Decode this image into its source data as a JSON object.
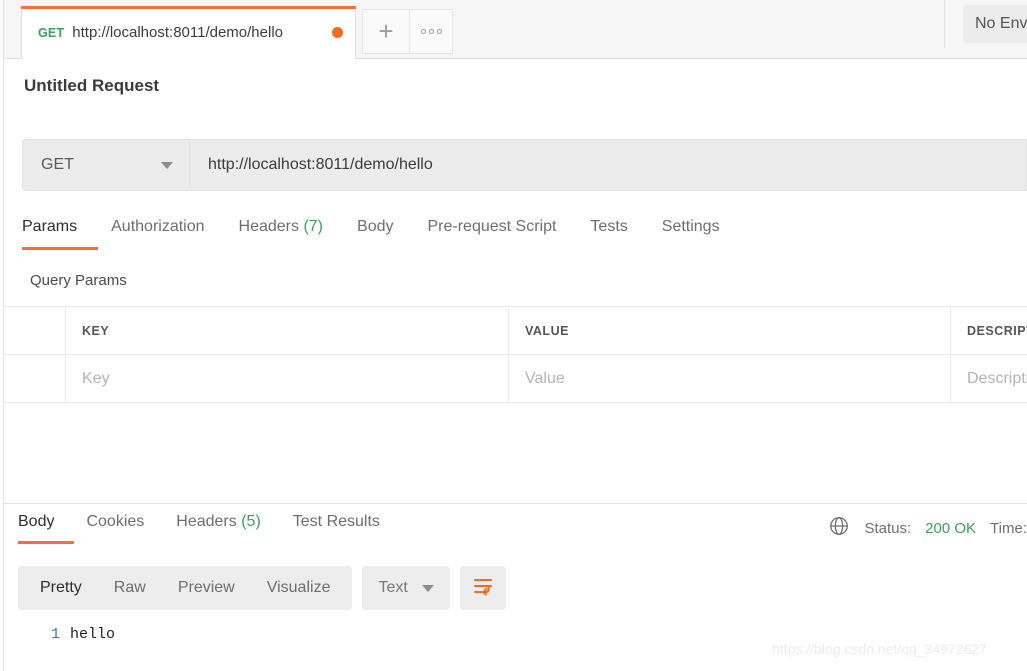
{
  "tab_bar": {
    "request_tab": {
      "method": "GET",
      "url": "http://localhost:8011/demo/hello",
      "unsaved_indicator": "unsaved-dot"
    },
    "new_tab_label": "+",
    "more_label": "more-options",
    "environment_selector": "No Env"
  },
  "request": {
    "title": "Untitled Request",
    "method": "GET",
    "url": "http://localhost:8011/demo/hello",
    "tabs": [
      {
        "label": "Params",
        "count": "",
        "active": true
      },
      {
        "label": "Authorization",
        "count": "",
        "active": false
      },
      {
        "label": "Headers",
        "count": "(7)",
        "active": false
      },
      {
        "label": "Body",
        "count": "",
        "active": false
      },
      {
        "label": "Pre-request Script",
        "count": "",
        "active": false
      },
      {
        "label": "Tests",
        "count": "",
        "active": false
      },
      {
        "label": "Settings",
        "count": "",
        "active": false
      }
    ],
    "query_params": {
      "section_title": "Query Params",
      "columns": [
        "",
        "KEY",
        "VALUE",
        "DESCRIPTION"
      ],
      "rows": [
        {
          "key": "Key",
          "value": "Value",
          "description": "Description"
        }
      ]
    }
  },
  "response": {
    "tabs": [
      {
        "label": "Body",
        "count": "",
        "active": true
      },
      {
        "label": "Cookies",
        "count": "",
        "active": false
      },
      {
        "label": "Headers",
        "count": "(5)",
        "active": false
      },
      {
        "label": "Test Results",
        "count": "",
        "active": false
      }
    ],
    "meta": {
      "globe_icon": "globe-icon",
      "status_label": "Status:",
      "status_value": "200 OK",
      "time_label": "Time:"
    },
    "viewer": {
      "modes": [
        {
          "label": "Pretty",
          "active": true
        },
        {
          "label": "Raw",
          "active": false
        },
        {
          "label": "Preview",
          "active": false
        },
        {
          "label": "Visualize",
          "active": false
        }
      ],
      "format": "Text",
      "wrap_icon": "word-wrap-icon"
    },
    "body": {
      "lines": [
        {
          "number": "1",
          "text": "hello"
        }
      ]
    }
  },
  "watermark": "https://blog.csdn.net/qq_34972627",
  "colors": {
    "accent": "#ff6c37",
    "success": "#3aa05a",
    "unsaved_dot": "#f26b21",
    "line_number": "#2f7fa8"
  }
}
